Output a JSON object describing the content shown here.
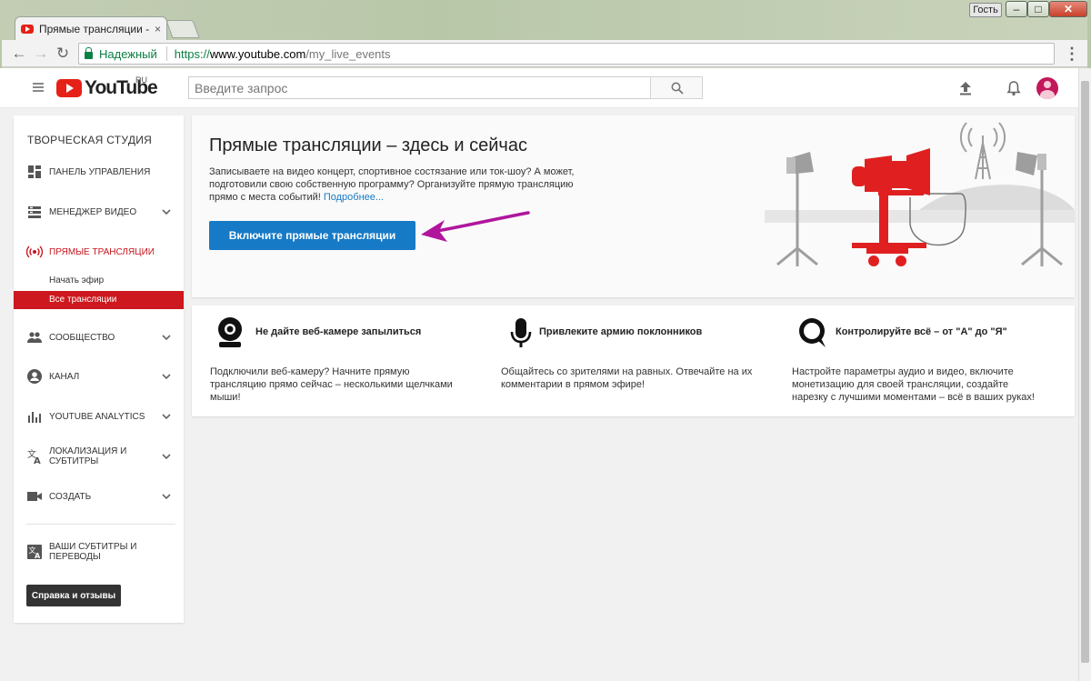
{
  "browser": {
    "tab_title": "Прямые трансляции - Y",
    "tab_close": "×",
    "guest_label": "Гость",
    "window_min": "–",
    "window_max": "□",
    "window_close": "✕",
    "nav_back": "←",
    "nav_forward": "→",
    "nav_reload": "↻",
    "secure_label": "Надежный",
    "url_scheme": "https://",
    "url_host": "www.youtube.com",
    "url_path": "/my_live_events",
    "menu": "⋮"
  },
  "header": {
    "logo_text": "YouTube",
    "region": "RU",
    "search_placeholder": "Введите запрос"
  },
  "sidebar": {
    "title": "ТВОРЧЕСКАЯ СТУДИЯ",
    "items": [
      {
        "label": "ПАНЕЛЬ УПРАВЛЕНИЯ",
        "icon": "dashboard-icon"
      },
      {
        "label": "МЕНЕДЖЕР ВИДЕО",
        "icon": "video-manager-icon"
      },
      {
        "label": "ПРЯМЫЕ ТРАНСЛЯЦИИ",
        "icon": "live-icon"
      },
      {
        "label": "СООБЩЕСТВО",
        "icon": "community-icon"
      },
      {
        "label": "КАНАЛ",
        "icon": "channel-icon"
      },
      {
        "label": "YOUTUBE ANALYTICS",
        "icon": "analytics-icon"
      },
      {
        "label_line1": "ЛОКАЛИЗАЦИЯ И",
        "label_line2": "СУБТИТРЫ",
        "icon": "translate-icon"
      },
      {
        "label": "СОЗДАТЬ",
        "icon": "create-icon"
      },
      {
        "label_line1": "ВАШИ СУБТИТРЫ И",
        "label_line2": "ПЕРЕВОДЫ",
        "icon": "subtitles-icon"
      }
    ],
    "sub_items": [
      "Начать эфир",
      "Все трансляции"
    ],
    "help_button": "Справка и отзывы",
    "accent": "#cc181e"
  },
  "hero": {
    "title": "Прямые трансляции – здесь и сейчас",
    "description": "Записываете на видео концерт, спортивное состязание или ток-шоу? А может, подготовили свою собственную программу? Организуйте прямую трансляцию прямо с места событий! ",
    "more_link": "Подробнее...",
    "cta_button": "Включите прямые трансляции",
    "cta_color": "#167ac6",
    "arrow_color": "#b0169c"
  },
  "features": [
    {
      "title": "Не дайте веб-камере запылиться",
      "description": "Подключили веб-камеру? Начните прямую трансляцию прямо сейчас – несколькими щелчками мыши!",
      "icon": "webcam-icon"
    },
    {
      "title": "Привлеките армию поклонников",
      "description": "Общайтесь со зрителями на равных. Отвечайте на их комментарии в прямом эфире!",
      "icon": "microphone-icon"
    },
    {
      "title": "Контролируйте всё – от \"А\" до \"Я\"",
      "description": "Настройте параметры аудио и видео, включите монетизацию для своей трансляции, создайте нарезку с лучшими моментами – всё в ваших руках!",
      "icon": "chat-bubble-icon"
    }
  ]
}
